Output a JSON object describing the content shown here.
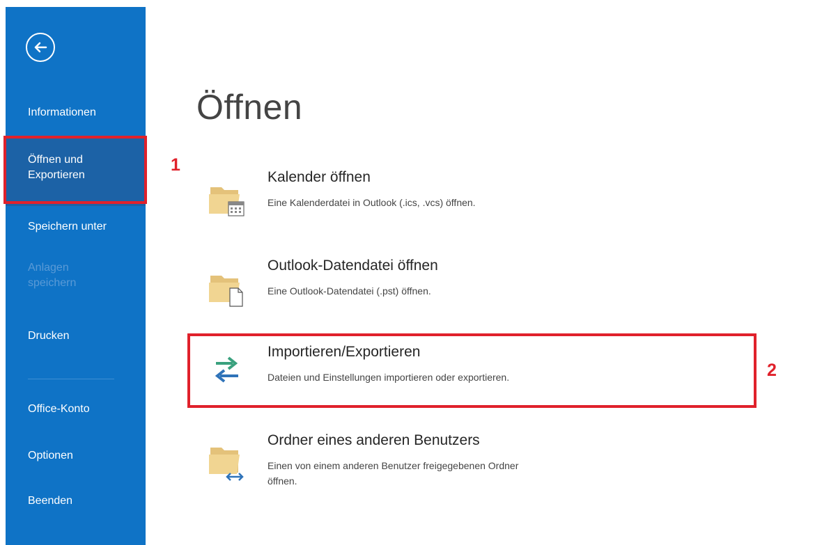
{
  "sidebar": {
    "items": [
      {
        "label": "Informationen"
      },
      {
        "label": "Öffnen und"
      },
      {
        "label": "Exportieren"
      },
      {
        "label": "Speichern unter"
      },
      {
        "label": "Anlagen"
      },
      {
        "label": "speichern"
      },
      {
        "label": "Drucken"
      },
      {
        "label": "Office-Konto"
      },
      {
        "label": "Optionen"
      },
      {
        "label": "Beenden"
      }
    ]
  },
  "annotations": {
    "marker1": "1",
    "marker2": "2"
  },
  "main": {
    "title": "Öffnen",
    "options": [
      {
        "title": "Kalender öffnen",
        "desc": "Eine Kalenderdatei in Outlook (.ics, .vcs) öffnen."
      },
      {
        "title": "Outlook-Datendatei öffnen",
        "desc": "Eine Outlook-Datendatei (.pst) öffnen."
      },
      {
        "title": "Importieren/Exportieren",
        "desc": "Dateien und Einstellungen importieren oder exportieren."
      },
      {
        "title": "Ordner eines anderen Benutzers",
        "desc1": "Einen von einem anderen Benutzer freigegebenen Ordner",
        "desc2": "öffnen."
      }
    ]
  },
  "colors": {
    "sidebar": "#0f73c6",
    "highlight": "#e0212b"
  }
}
